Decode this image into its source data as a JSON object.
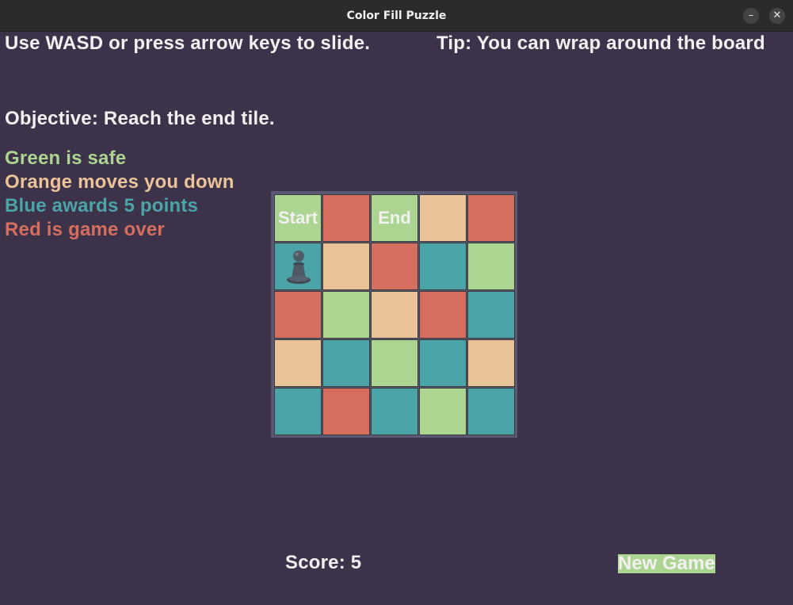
{
  "window": {
    "title": "Color Fill Puzzle",
    "minimize_glyph": "–",
    "close_glyph": "✕"
  },
  "instructions": {
    "controls": "Use WASD or press arrow keys to slide.",
    "tip": "Tip: You can wrap around the board",
    "objective": "Objective: Reach the end tile."
  },
  "legend": [
    {
      "text": "Green is safe",
      "color": "#acd591"
    },
    {
      "text": "Orange moves you down",
      "color": "#eac398"
    },
    {
      "text": "Blue awards 5 points",
      "color": "#4ba4a8"
    },
    {
      "text": "Red is game over",
      "color": "#d66e5f"
    }
  ],
  "colors": {
    "green": "#acd591",
    "orange": "#eac398",
    "blue": "#4ba4a8",
    "red": "#d66e5f",
    "background": "#3c3249"
  },
  "board": {
    "rows": 5,
    "cols": 5,
    "tiles": [
      [
        "green",
        "red",
        "green",
        "orange",
        "red"
      ],
      [
        "blue",
        "orange",
        "red",
        "blue",
        "green"
      ],
      [
        "red",
        "green",
        "orange",
        "red",
        "blue"
      ],
      [
        "orange",
        "blue",
        "green",
        "blue",
        "orange"
      ],
      [
        "blue",
        "red",
        "blue",
        "green",
        "blue"
      ]
    ],
    "labels": [
      {
        "row": 0,
        "col": 0,
        "text": "Start"
      },
      {
        "row": 0,
        "col": 2,
        "text": "End"
      }
    ],
    "player": {
      "row": 1,
      "col": 0,
      "icon": "pawn-icon"
    }
  },
  "score": {
    "text": "Score: 5"
  },
  "new_game": {
    "label": "New Game",
    "bg": "#acd591"
  }
}
